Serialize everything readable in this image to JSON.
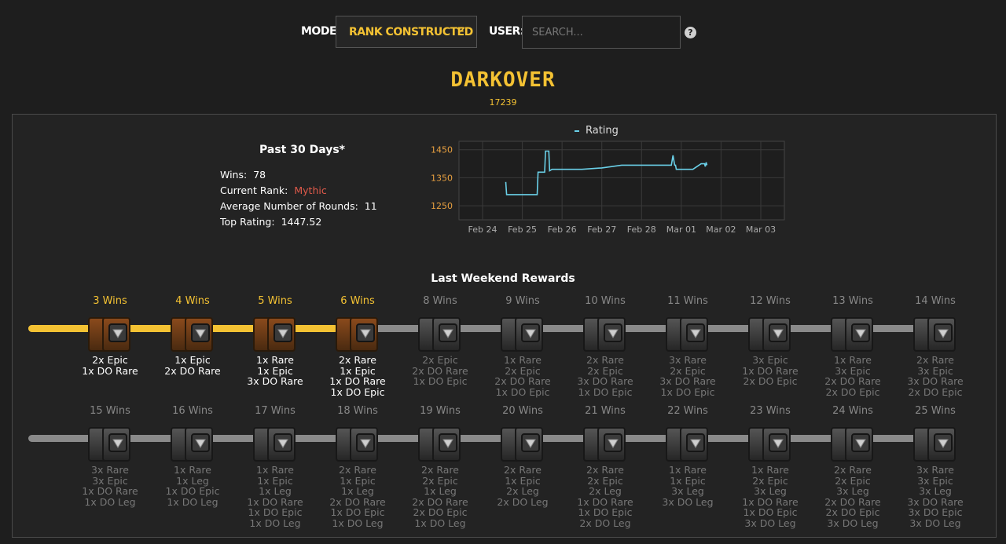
{
  "header": {
    "mode_label": "MODE:",
    "mode_value": "RANK CONSTRUCTED",
    "user_label": "USER:",
    "search_placeholder": "SEARCH...",
    "help": "?"
  },
  "player": {
    "name": "DARKOVER",
    "id": "17239"
  },
  "stats": {
    "title": "Past 30 Days*",
    "wins_label": "Wins:",
    "wins": "78",
    "rank_label": "Current Rank:",
    "rank": "Mythic",
    "rounds_label": "Average Number of Rounds:",
    "rounds": "11",
    "top_label": "Top Rating:",
    "top": "1447.52"
  },
  "colors": {
    "accent": "#f4c233",
    "series": "#6ad0e8",
    "rank": "#e05a4a"
  },
  "chart_data": {
    "type": "line",
    "series": [
      {
        "name": "Rating",
        "x": [
          "Feb 24 14:00",
          "Feb 24 14:30",
          "Feb 25 00:00",
          "Feb 25 00:30",
          "Feb 25 09:00",
          "Feb 25 09:30",
          "Feb 25 12:00",
          "Feb 25 12:30",
          "Feb 25 13:30",
          "Feb 25 14:00",
          "Feb 25 15:00",
          "Feb 25 16:00",
          "Feb 25 16:30",
          "Feb 25 18:00",
          "Feb 26 00:00",
          "Feb 26 03:00",
          "Feb 26 12:00",
          "Feb 27 00:00",
          "Feb 27 12:00",
          "Feb 28 06:00",
          "Feb 28 10:00",
          "Feb 28 18:00",
          "Feb 28 19:00",
          "Feb 28 20:00",
          "Feb 28 20:30",
          "Feb 28 21:00",
          "Mar 01 00:00",
          "Mar 01 06:00",
          "Mar 01 07:00",
          "Mar 01 12:00",
          "Mar 01 14:00",
          "Mar 01 14:30",
          "Mar 01 15:00",
          "Mar 01 15:30"
        ],
        "values": [
          1335,
          1290,
          1290,
          1290,
          1290,
          1370,
          1370,
          1370,
          1370,
          1445,
          1445,
          1445,
          1375,
          1380,
          1380,
          1380,
          1380,
          1385,
          1395,
          1395,
          1395,
          1395,
          1430,
          1395,
          1395,
          1380,
          1380,
          1380,
          1380,
          1400,
          1400,
          1390,
          1405,
          1395
        ]
      }
    ],
    "xticks": [
      "Feb 24",
      "Feb 25",
      "Feb 26",
      "Feb 27",
      "Feb 28",
      "Mar 01",
      "Mar 02",
      "Mar 03"
    ],
    "yticks": [
      1250,
      1350,
      1450
    ],
    "ylim": [
      1200,
      1480
    ],
    "grid": true,
    "legend": "top-center"
  },
  "rewards": {
    "title": "Last Weekend Rewards",
    "row1": [
      {
        "wins": "3 Wins",
        "active": true,
        "items": [
          "2x Epic",
          "1x DO Rare"
        ]
      },
      {
        "wins": "4 Wins",
        "active": true,
        "items": [
          "1x Epic",
          "2x DO Rare"
        ]
      },
      {
        "wins": "5 Wins",
        "active": true,
        "items": [
          "1x Rare",
          "1x Epic",
          "3x DO Rare"
        ]
      },
      {
        "wins": "6 Wins",
        "active": true,
        "items": [
          "2x Rare",
          "1x Epic",
          "1x DO Rare",
          "1x DO Epic"
        ]
      },
      {
        "wins": "8 Wins",
        "active": false,
        "items": [
          "2x Epic",
          "2x DO Rare",
          "1x DO Epic"
        ]
      },
      {
        "wins": "9 Wins",
        "active": false,
        "items": [
          "1x Rare",
          "2x Epic",
          "2x DO Rare",
          "1x DO Epic"
        ]
      },
      {
        "wins": "10 Wins",
        "active": false,
        "items": [
          "2x Rare",
          "2x Epic",
          "3x DO Rare",
          "1x DO Epic"
        ]
      },
      {
        "wins": "11 Wins",
        "active": false,
        "items": [
          "3x Rare",
          "2x Epic",
          "3x DO Rare",
          "1x DO Epic"
        ]
      },
      {
        "wins": "12 Wins",
        "active": false,
        "items": [
          "3x Epic",
          "1x DO Rare",
          "2x DO Epic"
        ]
      },
      {
        "wins": "13 Wins",
        "active": false,
        "items": [
          "1x Rare",
          "3x Epic",
          "2x DO Rare",
          "2x DO Epic"
        ]
      },
      {
        "wins": "14 Wins",
        "active": false,
        "items": [
          "2x Rare",
          "3x Epic",
          "3x DO Rare",
          "2x DO Epic"
        ]
      }
    ],
    "row2": [
      {
        "wins": "15 Wins",
        "active": false,
        "items": [
          "3x Rare",
          "3x Epic",
          "1x DO Rare",
          "1x DO Leg"
        ]
      },
      {
        "wins": "16 Wins",
        "active": false,
        "items": [
          "1x Rare",
          "1x Leg",
          "1x DO Epic",
          "1x DO Leg"
        ]
      },
      {
        "wins": "17 Wins",
        "active": false,
        "items": [
          "1x Rare",
          "1x Epic",
          "1x Leg",
          "1x DO Rare",
          "1x DO Epic",
          "1x DO Leg"
        ]
      },
      {
        "wins": "18 Wins",
        "active": false,
        "items": [
          "2x Rare",
          "1x Epic",
          "1x Leg",
          "2x DO Rare",
          "1x DO Epic",
          "1x DO Leg"
        ]
      },
      {
        "wins": "19 Wins",
        "active": false,
        "items": [
          "2x Rare",
          "2x Epic",
          "1x Leg",
          "2x DO Rare",
          "2x DO Epic",
          "1x DO Leg"
        ]
      },
      {
        "wins": "20 Wins",
        "active": false,
        "items": [
          "2x Rare",
          "1x Epic",
          "2x Leg",
          "2x DO Leg"
        ]
      },
      {
        "wins": "21 Wins",
        "active": false,
        "items": [
          "2x Rare",
          "2x Epic",
          "2x Leg",
          "1x DO Rare",
          "1x DO Epic",
          "2x DO Leg"
        ]
      },
      {
        "wins": "22 Wins",
        "active": false,
        "items": [
          "1x Rare",
          "1x Epic",
          "3x Leg",
          "3x DO Leg"
        ]
      },
      {
        "wins": "23 Wins",
        "active": false,
        "items": [
          "1x Rare",
          "2x Epic",
          "3x Leg",
          "1x DO Rare",
          "1x DO Epic",
          "3x DO Leg"
        ]
      },
      {
        "wins": "24 Wins",
        "active": false,
        "items": [
          "2x Rare",
          "2x Epic",
          "3x Leg",
          "2x DO Rare",
          "2x DO Epic",
          "3x DO Leg"
        ]
      },
      {
        "wins": "25 Wins",
        "active": false,
        "items": [
          "3x Rare",
          "3x Epic",
          "3x Leg",
          "3x DO Rare",
          "3x DO Epic",
          "3x DO Leg"
        ]
      }
    ]
  }
}
